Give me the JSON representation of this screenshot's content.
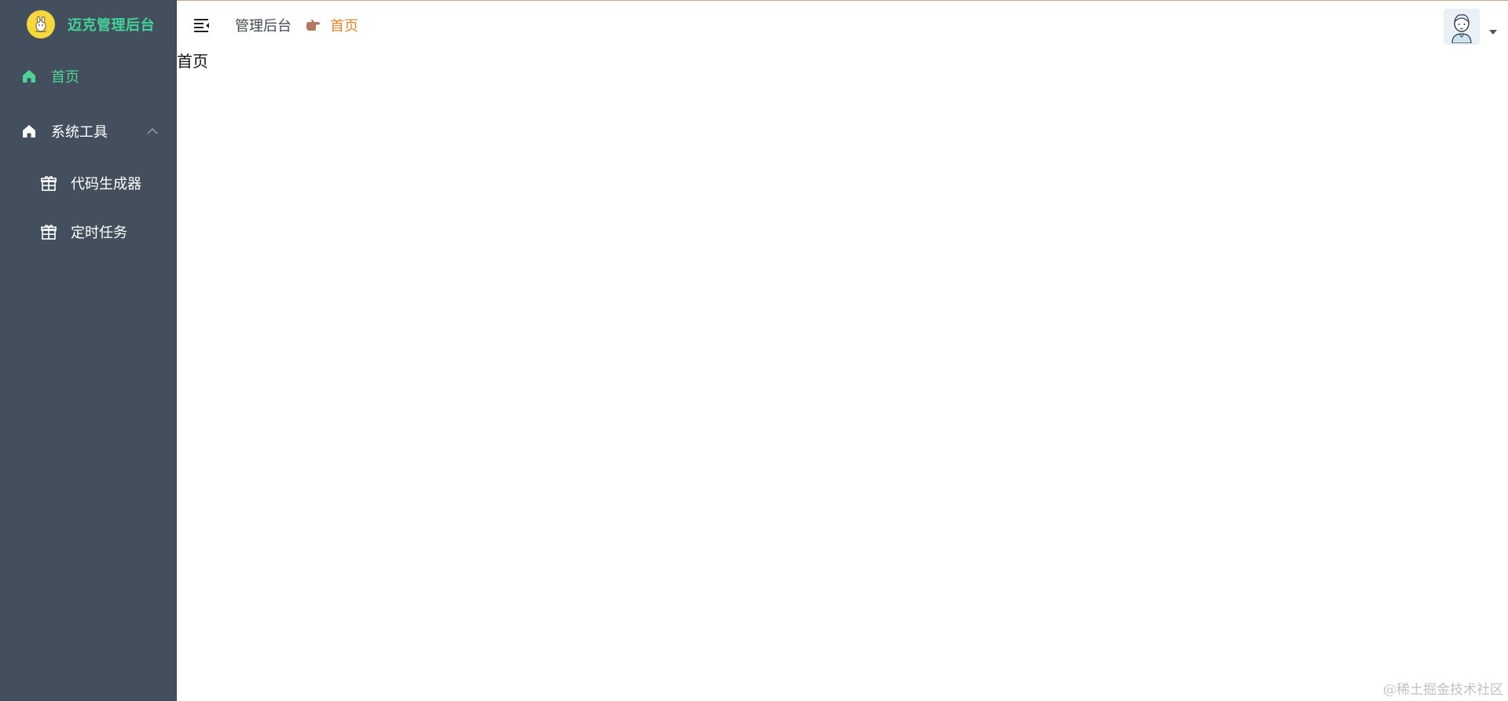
{
  "brand": {
    "title": "迈克管理后台"
  },
  "sidebar": {
    "items": [
      {
        "label": "首页",
        "icon": "home-icon",
        "active": true
      },
      {
        "label": "系统工具",
        "icon": "home-icon",
        "expanded": true,
        "children": [
          {
            "label": "代码生成器",
            "icon": "gift-icon"
          },
          {
            "label": "定时任务",
            "icon": "gift-icon"
          }
        ]
      }
    ]
  },
  "header": {
    "breadcrumb": {
      "root": "管理后台",
      "separator_icon": "pointing-hand-icon",
      "current": "首页"
    },
    "menu_toggle_icon": "menu-fold-icon",
    "user_dropdown_icon": "caret-down-icon"
  },
  "main": {
    "content": "首页"
  },
  "watermark": "@稀土掘金技术社区",
  "colors": {
    "sidebar_bg": "#434f5c",
    "brand_text": "#43d39a",
    "active_menu": "#4fd497",
    "breadcrumb_current": "#e8842c"
  }
}
